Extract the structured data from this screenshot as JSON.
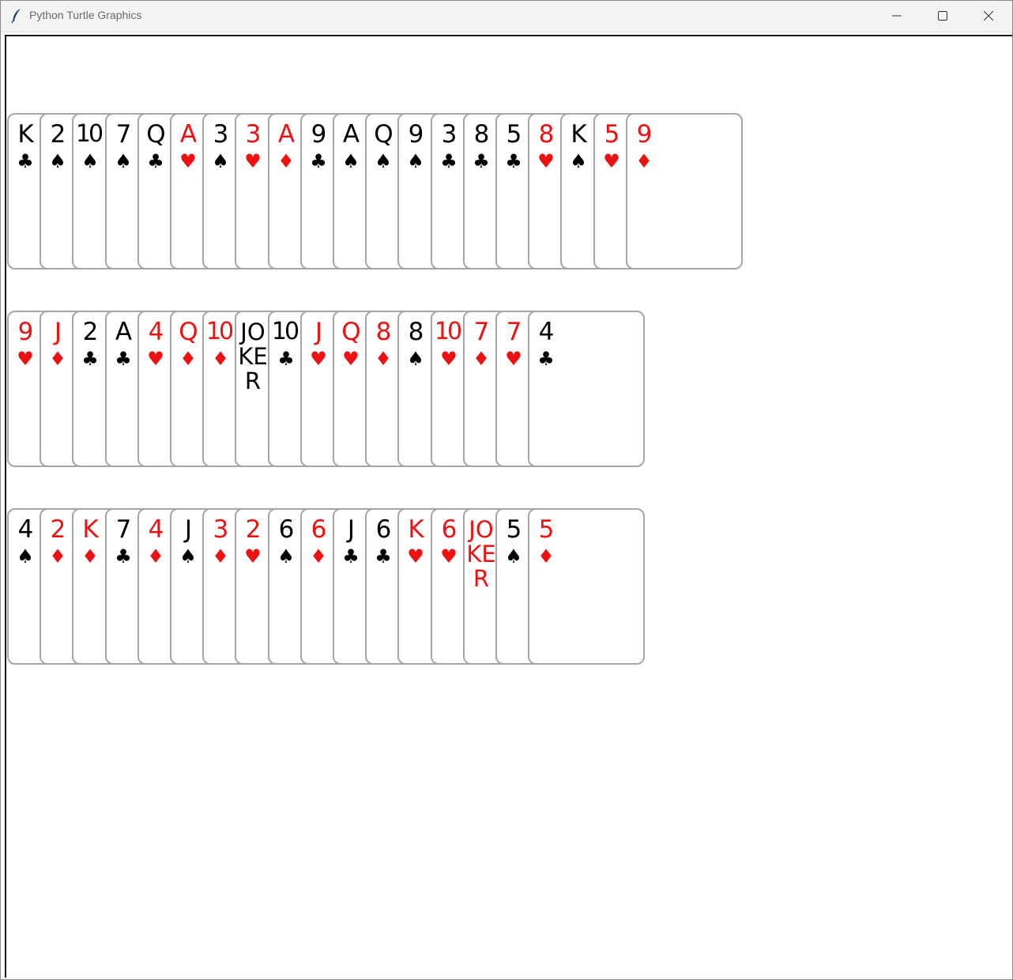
{
  "window": {
    "title": "Python Turtle Graphics",
    "controls": [
      "minimize-icon",
      "maximize-icon",
      "close-icon"
    ]
  },
  "colors": {
    "red_suit": "#ee1111",
    "black_suit": "#000000",
    "card_border": "#a6a6a6"
  },
  "rows": [
    {
      "cards": [
        {
          "rank": "K",
          "suit": "♣",
          "color": "black"
        },
        {
          "rank": "2",
          "suit": "♠",
          "color": "black"
        },
        {
          "rank": "10",
          "suit": "♠",
          "color": "black"
        },
        {
          "rank": "7",
          "suit": "♠",
          "color": "black"
        },
        {
          "rank": "Q",
          "suit": "♣",
          "color": "black"
        },
        {
          "rank": "A",
          "suit": "♥",
          "color": "red"
        },
        {
          "rank": "3",
          "suit": "♠",
          "color": "black"
        },
        {
          "rank": "3",
          "suit": "♥",
          "color": "red"
        },
        {
          "rank": "A",
          "suit": "♦",
          "color": "red"
        },
        {
          "rank": "9",
          "suit": "♣",
          "color": "black"
        },
        {
          "rank": "A",
          "suit": "♠",
          "color": "black"
        },
        {
          "rank": "Q",
          "suit": "♠",
          "color": "black"
        },
        {
          "rank": "9",
          "suit": "♠",
          "color": "black"
        },
        {
          "rank": "3",
          "suit": "♣",
          "color": "black"
        },
        {
          "rank": "8",
          "suit": "♣",
          "color": "black"
        },
        {
          "rank": "5",
          "suit": "♣",
          "color": "black"
        },
        {
          "rank": "8",
          "suit": "♥",
          "color": "red"
        },
        {
          "rank": "K",
          "suit": "♠",
          "color": "black"
        },
        {
          "rank": "5",
          "suit": "♥",
          "color": "red"
        },
        {
          "rank": "9",
          "suit": "♦",
          "color": "red"
        }
      ]
    },
    {
      "cards": [
        {
          "rank": "9",
          "suit": "♥",
          "color": "red"
        },
        {
          "rank": "J",
          "suit": "♦",
          "color": "red"
        },
        {
          "rank": "2",
          "suit": "♣",
          "color": "black"
        },
        {
          "rank": "A",
          "suit": "♣",
          "color": "black"
        },
        {
          "rank": "4",
          "suit": "♥",
          "color": "red"
        },
        {
          "rank": "Q",
          "suit": "♦",
          "color": "red"
        },
        {
          "rank": "10",
          "suit": "♦",
          "color": "red"
        },
        {
          "rank": "JOKER",
          "suit": "",
          "color": "black"
        },
        {
          "rank": "10",
          "suit": "♣",
          "color": "black"
        },
        {
          "rank": "J",
          "suit": "♥",
          "color": "red"
        },
        {
          "rank": "Q",
          "suit": "♥",
          "color": "red"
        },
        {
          "rank": "8",
          "suit": "♦",
          "color": "red"
        },
        {
          "rank": "8",
          "suit": "♠",
          "color": "black"
        },
        {
          "rank": "10",
          "suit": "♥",
          "color": "red"
        },
        {
          "rank": "7",
          "suit": "♦",
          "color": "red"
        },
        {
          "rank": "7",
          "suit": "♥",
          "color": "red"
        },
        {
          "rank": "4",
          "suit": "♣",
          "color": "black"
        }
      ]
    },
    {
      "cards": [
        {
          "rank": "4",
          "suit": "♠",
          "color": "black"
        },
        {
          "rank": "2",
          "suit": "♦",
          "color": "red"
        },
        {
          "rank": "K",
          "suit": "♦",
          "color": "red"
        },
        {
          "rank": "7",
          "suit": "♣",
          "color": "black"
        },
        {
          "rank": "4",
          "suit": "♦",
          "color": "red"
        },
        {
          "rank": "J",
          "suit": "♠",
          "color": "black"
        },
        {
          "rank": "3",
          "suit": "♦",
          "color": "red"
        },
        {
          "rank": "2",
          "suit": "♥",
          "color": "red"
        },
        {
          "rank": "6",
          "suit": "♠",
          "color": "black"
        },
        {
          "rank": "6",
          "suit": "♦",
          "color": "red"
        },
        {
          "rank": "J",
          "suit": "♣",
          "color": "black"
        },
        {
          "rank": "6",
          "suit": "♣",
          "color": "black"
        },
        {
          "rank": "K",
          "suit": "♥",
          "color": "red"
        },
        {
          "rank": "6",
          "suit": "♥",
          "color": "red"
        },
        {
          "rank": "JOKER",
          "suit": "",
          "color": "red"
        },
        {
          "rank": "5",
          "suit": "♠",
          "color": "black"
        },
        {
          "rank": "5",
          "suit": "♦",
          "color": "red"
        }
      ]
    }
  ]
}
